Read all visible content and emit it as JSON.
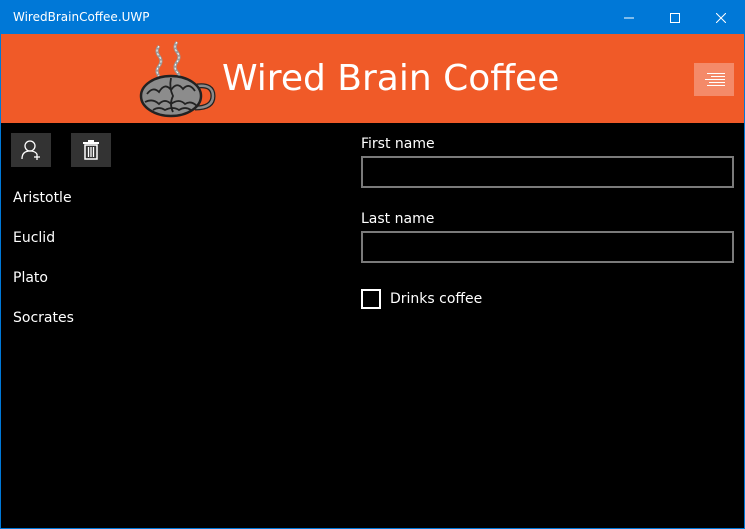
{
  "window": {
    "title": "WiredBrainCoffee.UWP"
  },
  "header": {
    "title": "Wired Brain Coffee",
    "background_color": "#f05a28",
    "menu_icon": "hamburger-menu-icon"
  },
  "toolbar": {
    "add_icon": "add-user-icon",
    "delete_icon": "trash-icon"
  },
  "customers": [
    {
      "name": "Aristotle"
    },
    {
      "name": "Euclid"
    },
    {
      "name": "Plato"
    },
    {
      "name": "Socrates"
    }
  ],
  "form": {
    "first_name_label": "First name",
    "first_name_value": "",
    "last_name_label": "Last name",
    "last_name_value": "",
    "drinks_coffee_label": "Drinks coffee",
    "drinks_coffee_checked": false
  },
  "colors": {
    "titlebar": "#0078d7",
    "header": "#f05a28",
    "background": "#000000"
  }
}
